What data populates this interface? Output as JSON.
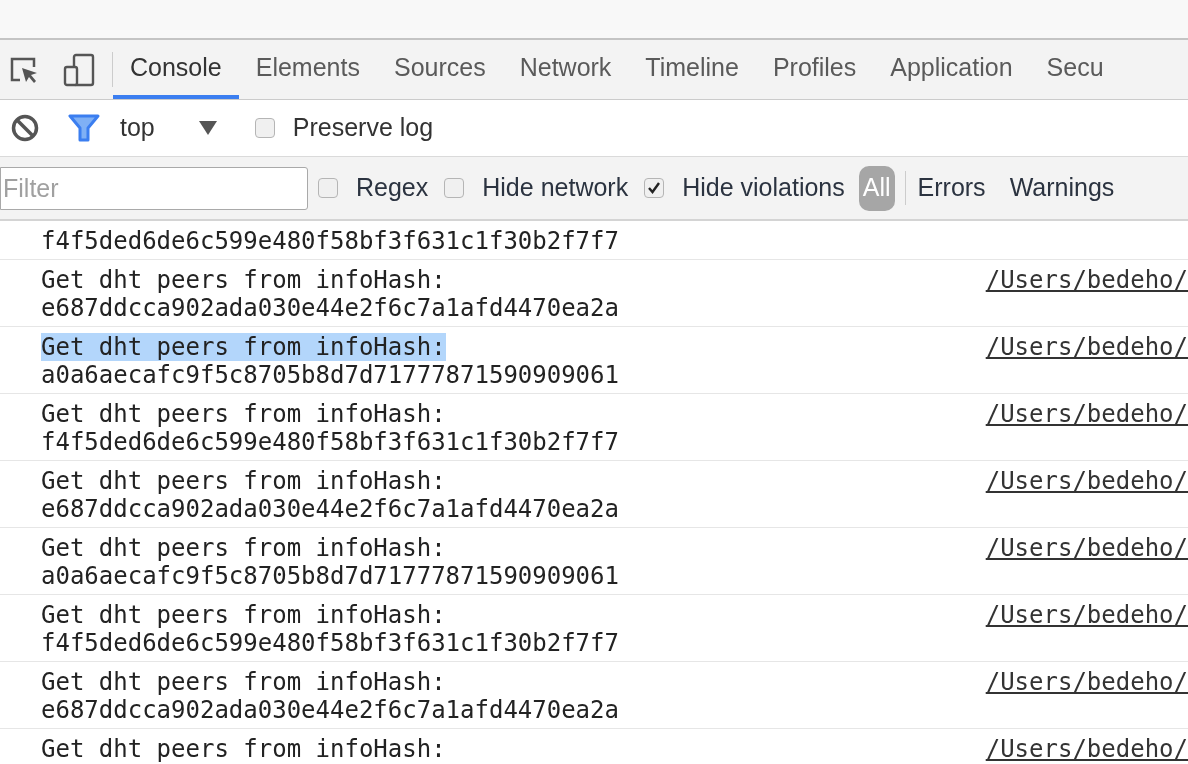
{
  "tabs": [
    {
      "label": "Console",
      "selected": true
    },
    {
      "label": "Elements",
      "selected": false
    },
    {
      "label": "Sources",
      "selected": false
    },
    {
      "label": "Network",
      "selected": false
    },
    {
      "label": "Timeline",
      "selected": false
    },
    {
      "label": "Profiles",
      "selected": false
    },
    {
      "label": "Application",
      "selected": false
    },
    {
      "label": "Secu",
      "selected": false
    }
  ],
  "toolbar": {
    "filter_active": true,
    "context": "top",
    "preserve_log": {
      "label": "Preserve log",
      "checked": false
    }
  },
  "filter_bar": {
    "placeholder": "Filter",
    "options": [
      {
        "label": "Regex",
        "checked": false
      },
      {
        "label": "Hide network",
        "checked": false
      },
      {
        "label": "Hide violations",
        "checked": true
      }
    ],
    "levels": [
      {
        "label": "All",
        "selected": true
      },
      {
        "label": "Errors",
        "selected": false
      },
      {
        "label": "Warnings",
        "selected": false
      }
    ]
  },
  "rows": [
    {
      "kind": "partial",
      "lines": [
        "f4f5ded6de6c599e480f58bf3f631c1f30b2f7f7"
      ]
    },
    {
      "kind": "full",
      "message": "Get dht peers from infoHash:",
      "highlighted": false,
      "lines": [
        "e687ddcca902ada030e44e2f6c7a1afd4470ea2a"
      ],
      "source": "/Users/bedeho/"
    },
    {
      "kind": "full",
      "message": "Get dht peers from infoHash:",
      "highlighted": true,
      "lines": [
        "a0a6aecafc9f5c8705b8d7d71777871590909061"
      ],
      "source": "/Users/bedeho/"
    },
    {
      "kind": "full",
      "message": "Get dht peers from infoHash:",
      "highlighted": false,
      "lines": [
        "f4f5ded6de6c599e480f58bf3f631c1f30b2f7f7"
      ],
      "source": "/Users/bedeho/"
    },
    {
      "kind": "full",
      "message": "Get dht peers from infoHash:",
      "highlighted": false,
      "lines": [
        "e687ddcca902ada030e44e2f6c7a1afd4470ea2a"
      ],
      "source": "/Users/bedeho/"
    },
    {
      "kind": "full",
      "message": "Get dht peers from infoHash:",
      "highlighted": false,
      "lines": [
        "a0a6aecafc9f5c8705b8d7d71777871590909061"
      ],
      "source": "/Users/bedeho/"
    },
    {
      "kind": "full",
      "message": "Get dht peers from infoHash:",
      "highlighted": false,
      "lines": [
        "f4f5ded6de6c599e480f58bf3f631c1f30b2f7f7"
      ],
      "source": "/Users/bedeho/"
    },
    {
      "kind": "full",
      "message": "Get dht peers from infoHash:",
      "highlighted": false,
      "lines": [
        "e687ddcca902ada030e44e2f6c7a1afd4470ea2a"
      ],
      "source": "/Users/bedeho/"
    },
    {
      "kind": "full",
      "message": "Get dht peers from infoHash:",
      "highlighted": false,
      "lines": [],
      "source": "/Users/bedeho/"
    }
  ]
}
